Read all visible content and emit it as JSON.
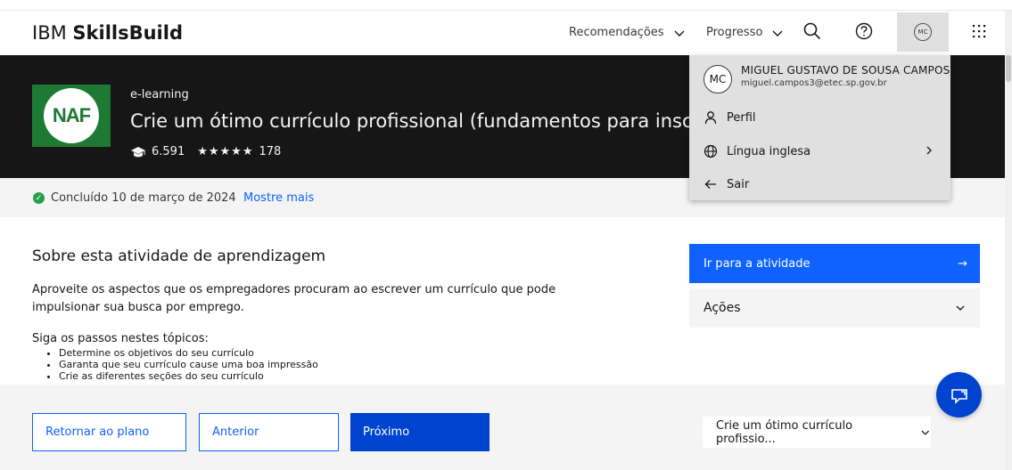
{
  "header": {
    "brand_light": "IBM ",
    "brand_bold": "SkillsBuild",
    "nav": [
      {
        "label": "Recomendações"
      },
      {
        "label": "Progresso"
      }
    ],
    "avatar_initials": "MC"
  },
  "banner": {
    "logo_text": "NAF",
    "type": "e-learning",
    "title": "Crie um ótimo currículo profissional (fundamentos para inscrição",
    "learners": "6.591",
    "stars": "★★★★★",
    "rating_count": "178"
  },
  "status": {
    "completed": "Concluído 10 de março de 2024",
    "show_more": "Mostre mais"
  },
  "about": {
    "heading": "Sobre esta atividade de aprendizagem",
    "paragraph": "Aproveite os aspectos que os empregadores procuram ao escrever um currículo que pode impulsionar sua busca por emprego.",
    "steps_heading": "Siga os passos nestes tópicos:",
    "steps": [
      "Determine os objetivos do seu currículo",
      "Garanta que seu currículo cause uma boa impressão",
      "Crie as diferentes seções do seu currículo"
    ]
  },
  "side": {
    "go_label": "Ir para a atividade",
    "go_arrow": "→",
    "actions_label": "Ações"
  },
  "bottom": {
    "back_plan": "Retornar ao plano",
    "previous": "Anterior",
    "next": "Próximo",
    "course_select": "Crie um ótimo currículo profissio..."
  },
  "profile_menu": {
    "initials": "MC",
    "name": "MIGUEL GUSTAVO DE SOUSA CAMPOS",
    "email": "miguel.campos3@etec.sp.gov.br",
    "items": [
      {
        "label": "Perfil",
        "icon": "user-icon"
      },
      {
        "label": "Língua inglesa",
        "icon": "globe-icon"
      },
      {
        "label": "Sair",
        "icon": "arrow-left-icon"
      }
    ]
  },
  "colors": {
    "primary_blue": "#0f62fe",
    "dark_blue": "#0043ce",
    "banner_bg": "#161616",
    "success_green": "#24a148",
    "logo_green": "#1d7a33"
  }
}
